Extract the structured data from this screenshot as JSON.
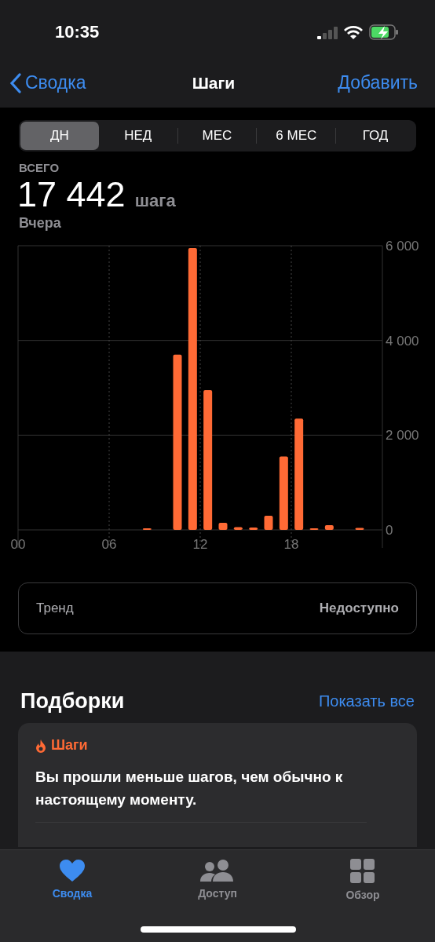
{
  "status_bar": {
    "time": "10:35"
  },
  "nav": {
    "back": "Сводка",
    "title": "Шаги",
    "action": "Добавить"
  },
  "segments": [
    {
      "label": "ДН",
      "selected": true
    },
    {
      "label": "НЕД",
      "selected": false
    },
    {
      "label": "МЕС",
      "selected": false
    },
    {
      "label": "6 МЕС",
      "selected": false
    },
    {
      "label": "ГОД",
      "selected": false
    }
  ],
  "summary": {
    "caption": "ВСЕГО",
    "value": "17 442",
    "unit": "шага",
    "date": "Вчера"
  },
  "chart_data": {
    "type": "bar",
    "grid": true,
    "x": [
      8.5,
      10.5,
      11.5,
      12.5,
      13.5,
      14.5,
      15.5,
      16.5,
      17.5,
      18.5,
      19.5,
      20.5,
      22.5
    ],
    "values": [
      20,
      3700,
      5950,
      2950,
      150,
      60,
      50,
      300,
      1550,
      2350,
      20,
      100,
      40
    ],
    "xlim": [
      0,
      24
    ],
    "ylim": [
      0,
      6000
    ],
    "xticks": [
      {
        "value": 0,
        "label": "00"
      },
      {
        "value": 6,
        "label": "06"
      },
      {
        "value": 12,
        "label": "12"
      },
      {
        "value": 18,
        "label": "18"
      }
    ],
    "yticks": [
      {
        "value": 0,
        "label": "0"
      },
      {
        "value": 2000,
        "label": "2 000"
      },
      {
        "value": 4000,
        "label": "4 000"
      },
      {
        "value": 6000,
        "label": "6 000"
      }
    ]
  },
  "trend": {
    "label": "Тренд",
    "value": "Недоступно"
  },
  "highlights": {
    "title": "Подборки",
    "action": "Показать все",
    "card": {
      "category": "Шаги",
      "text": "Вы прошли меньше шагов, чем обычно к настоящему моменту."
    }
  },
  "tab_bar": [
    {
      "kind": "heart",
      "label": "Сводка",
      "selected": true
    },
    {
      "kind": "people",
      "label": "Доступ",
      "selected": false
    },
    {
      "kind": "grid",
      "label": "Обзор",
      "selected": false
    }
  ]
}
